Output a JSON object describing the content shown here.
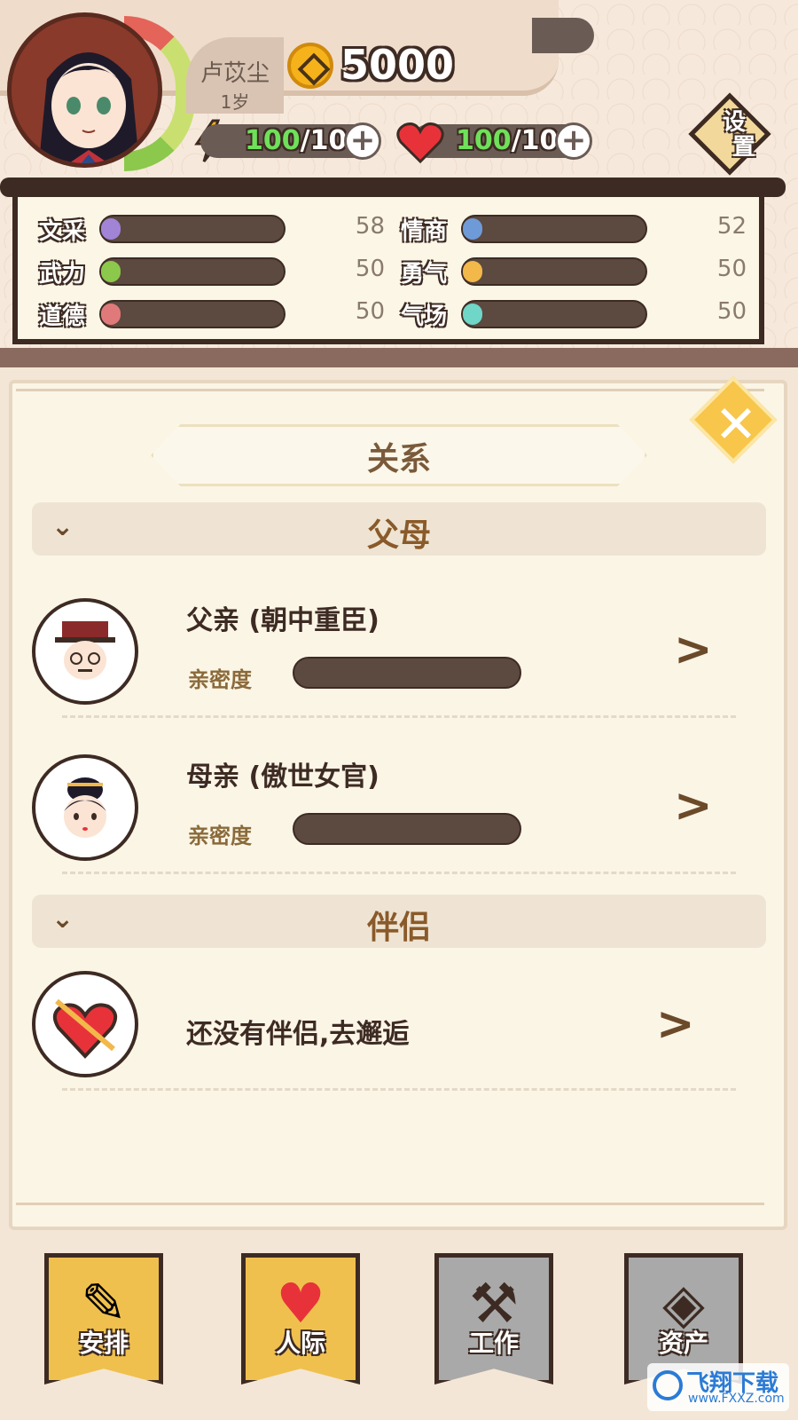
{
  "player": {
    "name": "卢苡尘",
    "age": "1岁",
    "coins": "5000",
    "energy_current": "100",
    "energy_max": "/100",
    "health_current": "100",
    "health_max": "/100"
  },
  "settings_label_1": "设",
  "settings_label_2": "置",
  "stats": [
    {
      "label": "文采",
      "value": "58",
      "color": "#a184d6"
    },
    {
      "label": "情商",
      "value": "52",
      "color": "#6f9ad8"
    },
    {
      "label": "武力",
      "value": "50",
      "color": "#8cc84b"
    },
    {
      "label": "勇气",
      "value": "50",
      "color": "#f2b84a"
    },
    {
      "label": "道德",
      "value": "50",
      "color": "#e07a7a"
    },
    {
      "label": "气场",
      "value": "50",
      "color": "#6fd6c8"
    }
  ],
  "panel": {
    "title": "关系",
    "close_icon": "✕"
  },
  "sections": {
    "parents": {
      "title": "父母",
      "members": [
        {
          "name": "父亲 (朝中重臣)",
          "intimacy_label": "亲密度"
        },
        {
          "name": "母亲 (傲世女官)",
          "intimacy_label": "亲密度"
        }
      ]
    },
    "partner": {
      "title": "伴侣",
      "empty_text": "还没有伴侣,去邂逅"
    }
  },
  "nav": [
    {
      "label": "安排",
      "icon": "pencil-paper-icon"
    },
    {
      "label": "人际",
      "icon": "heart-arrow-icon"
    },
    {
      "label": "工作",
      "icon": "hammer-icon"
    },
    {
      "label": "资产",
      "icon": "coin-icon"
    }
  ],
  "watermark": {
    "title": "飞翔下载",
    "url": "www.FXXZ.com"
  }
}
